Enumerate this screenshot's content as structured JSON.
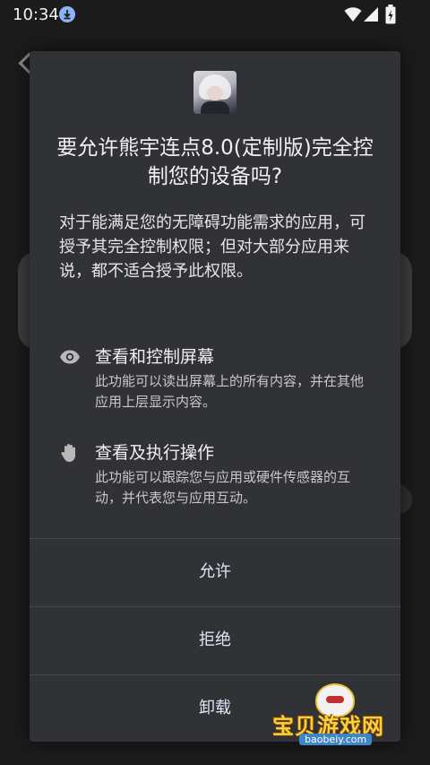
{
  "status_bar": {
    "time": "10:34",
    "icons": [
      "download-icon",
      "wifi-icon",
      "signal-icon",
      "battery-charging-icon"
    ]
  },
  "dialog": {
    "app_icon": "app-avatar-icon",
    "title": "要允许熊宇连点8.0(定制版)完全控制您的设备吗?",
    "description": "对于能满足您的无障碍功能需求的应用，可授予其完全控制权限；但对大部分应用来说，都不适合授予此权限。",
    "permissions": [
      {
        "icon": "eye-icon",
        "title": "查看和控制屏幕",
        "description": "此功能可以读出屏幕上的所有内容，并在其他应用上层显示内容。"
      },
      {
        "icon": "hand-icon",
        "title": "查看及执行操作",
        "description": "此功能可以跟踪您与应用或硬件传感器的互动，并代表您与应用互动。"
      }
    ],
    "buttons": {
      "allow": "允许",
      "deny": "拒绝",
      "uninstall": "卸载"
    },
    "colors": {
      "dialog_bg": "#303236",
      "button_text": "#dfe6f5"
    }
  },
  "watermark": {
    "text": "宝贝游戏网",
    "url": "baobeiy.com"
  }
}
